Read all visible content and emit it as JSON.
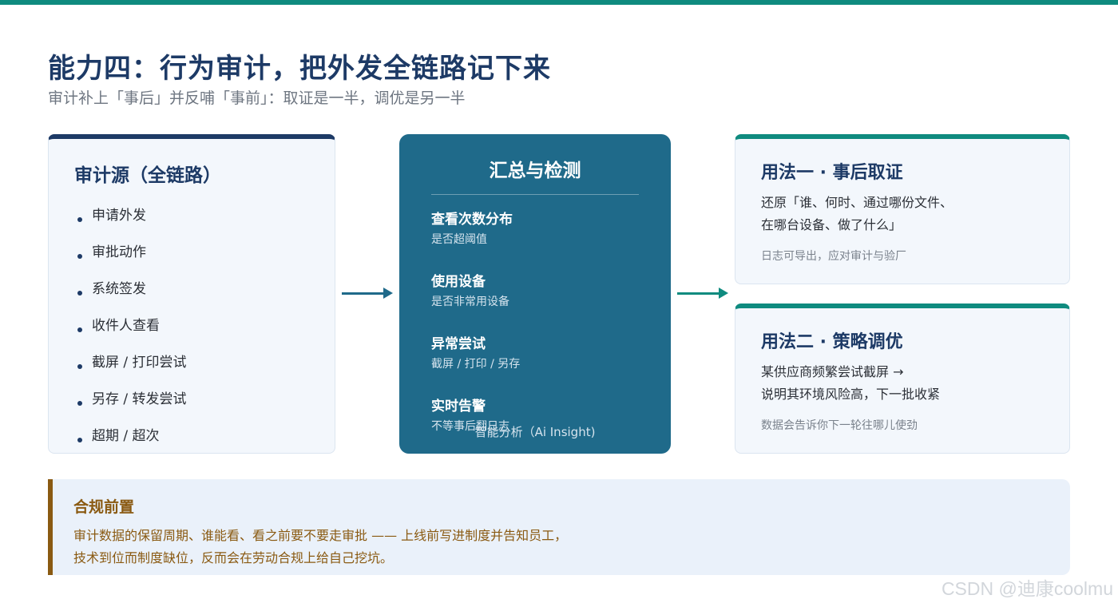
{
  "colors": {
    "accent_teal": "#0f8b7f",
    "navy": "#1d3a66",
    "center_box": "#1f6a8a",
    "compliance_brown": "#8a5a12",
    "card_bg": "#f3f7fc"
  },
  "header": {
    "title": "能力四：行为审计，把外发全链路记下来",
    "subtitle": "审计补上「事后」并反哺「事前」：取证是一半，调优是另一半"
  },
  "sources": {
    "title": "审计源（全链路）",
    "items": [
      "申请外发",
      "审批动作",
      "系统签发",
      "收件人查看",
      "截屏 / 打印尝试",
      "另存 / 转发尝试",
      "超期 / 超次"
    ]
  },
  "detection": {
    "title": "汇总与检测",
    "items": [
      {
        "title": "查看次数分布",
        "desc": "是否超阈值"
      },
      {
        "title": "使用设备",
        "desc": "是否非常用设备"
      },
      {
        "title": "异常尝试",
        "desc": "截屏 / 打印 / 另存"
      },
      {
        "title": "实时告警",
        "desc": "不等事后翻日志"
      }
    ],
    "footer": "智能分析（Ai Insight)"
  },
  "usage1": {
    "title": "用法一 · 事后取证",
    "lines": [
      "还原「谁、何时、通过哪份文件、",
      "在哪台设备、做了什么」"
    ],
    "note": "日志可导出，应对审计与验厂"
  },
  "usage2": {
    "title": "用法二 · 策略调优",
    "lines": [
      "某供应商频繁尝试截屏 →",
      "说明其环境风险高，下一批收紧"
    ],
    "note": "数据会告诉你下一轮往哪儿使劲"
  },
  "compliance": {
    "title": "合规前置",
    "lines": [
      "审计数据的保留周期、谁能看、看之前要不要走审批 —— 上线前写进制度并告知员工，",
      "技术到位而制度缺位，反而会在劳动合规上给自己挖坑。"
    ]
  },
  "watermark": "CSDN @迪康coolmu"
}
